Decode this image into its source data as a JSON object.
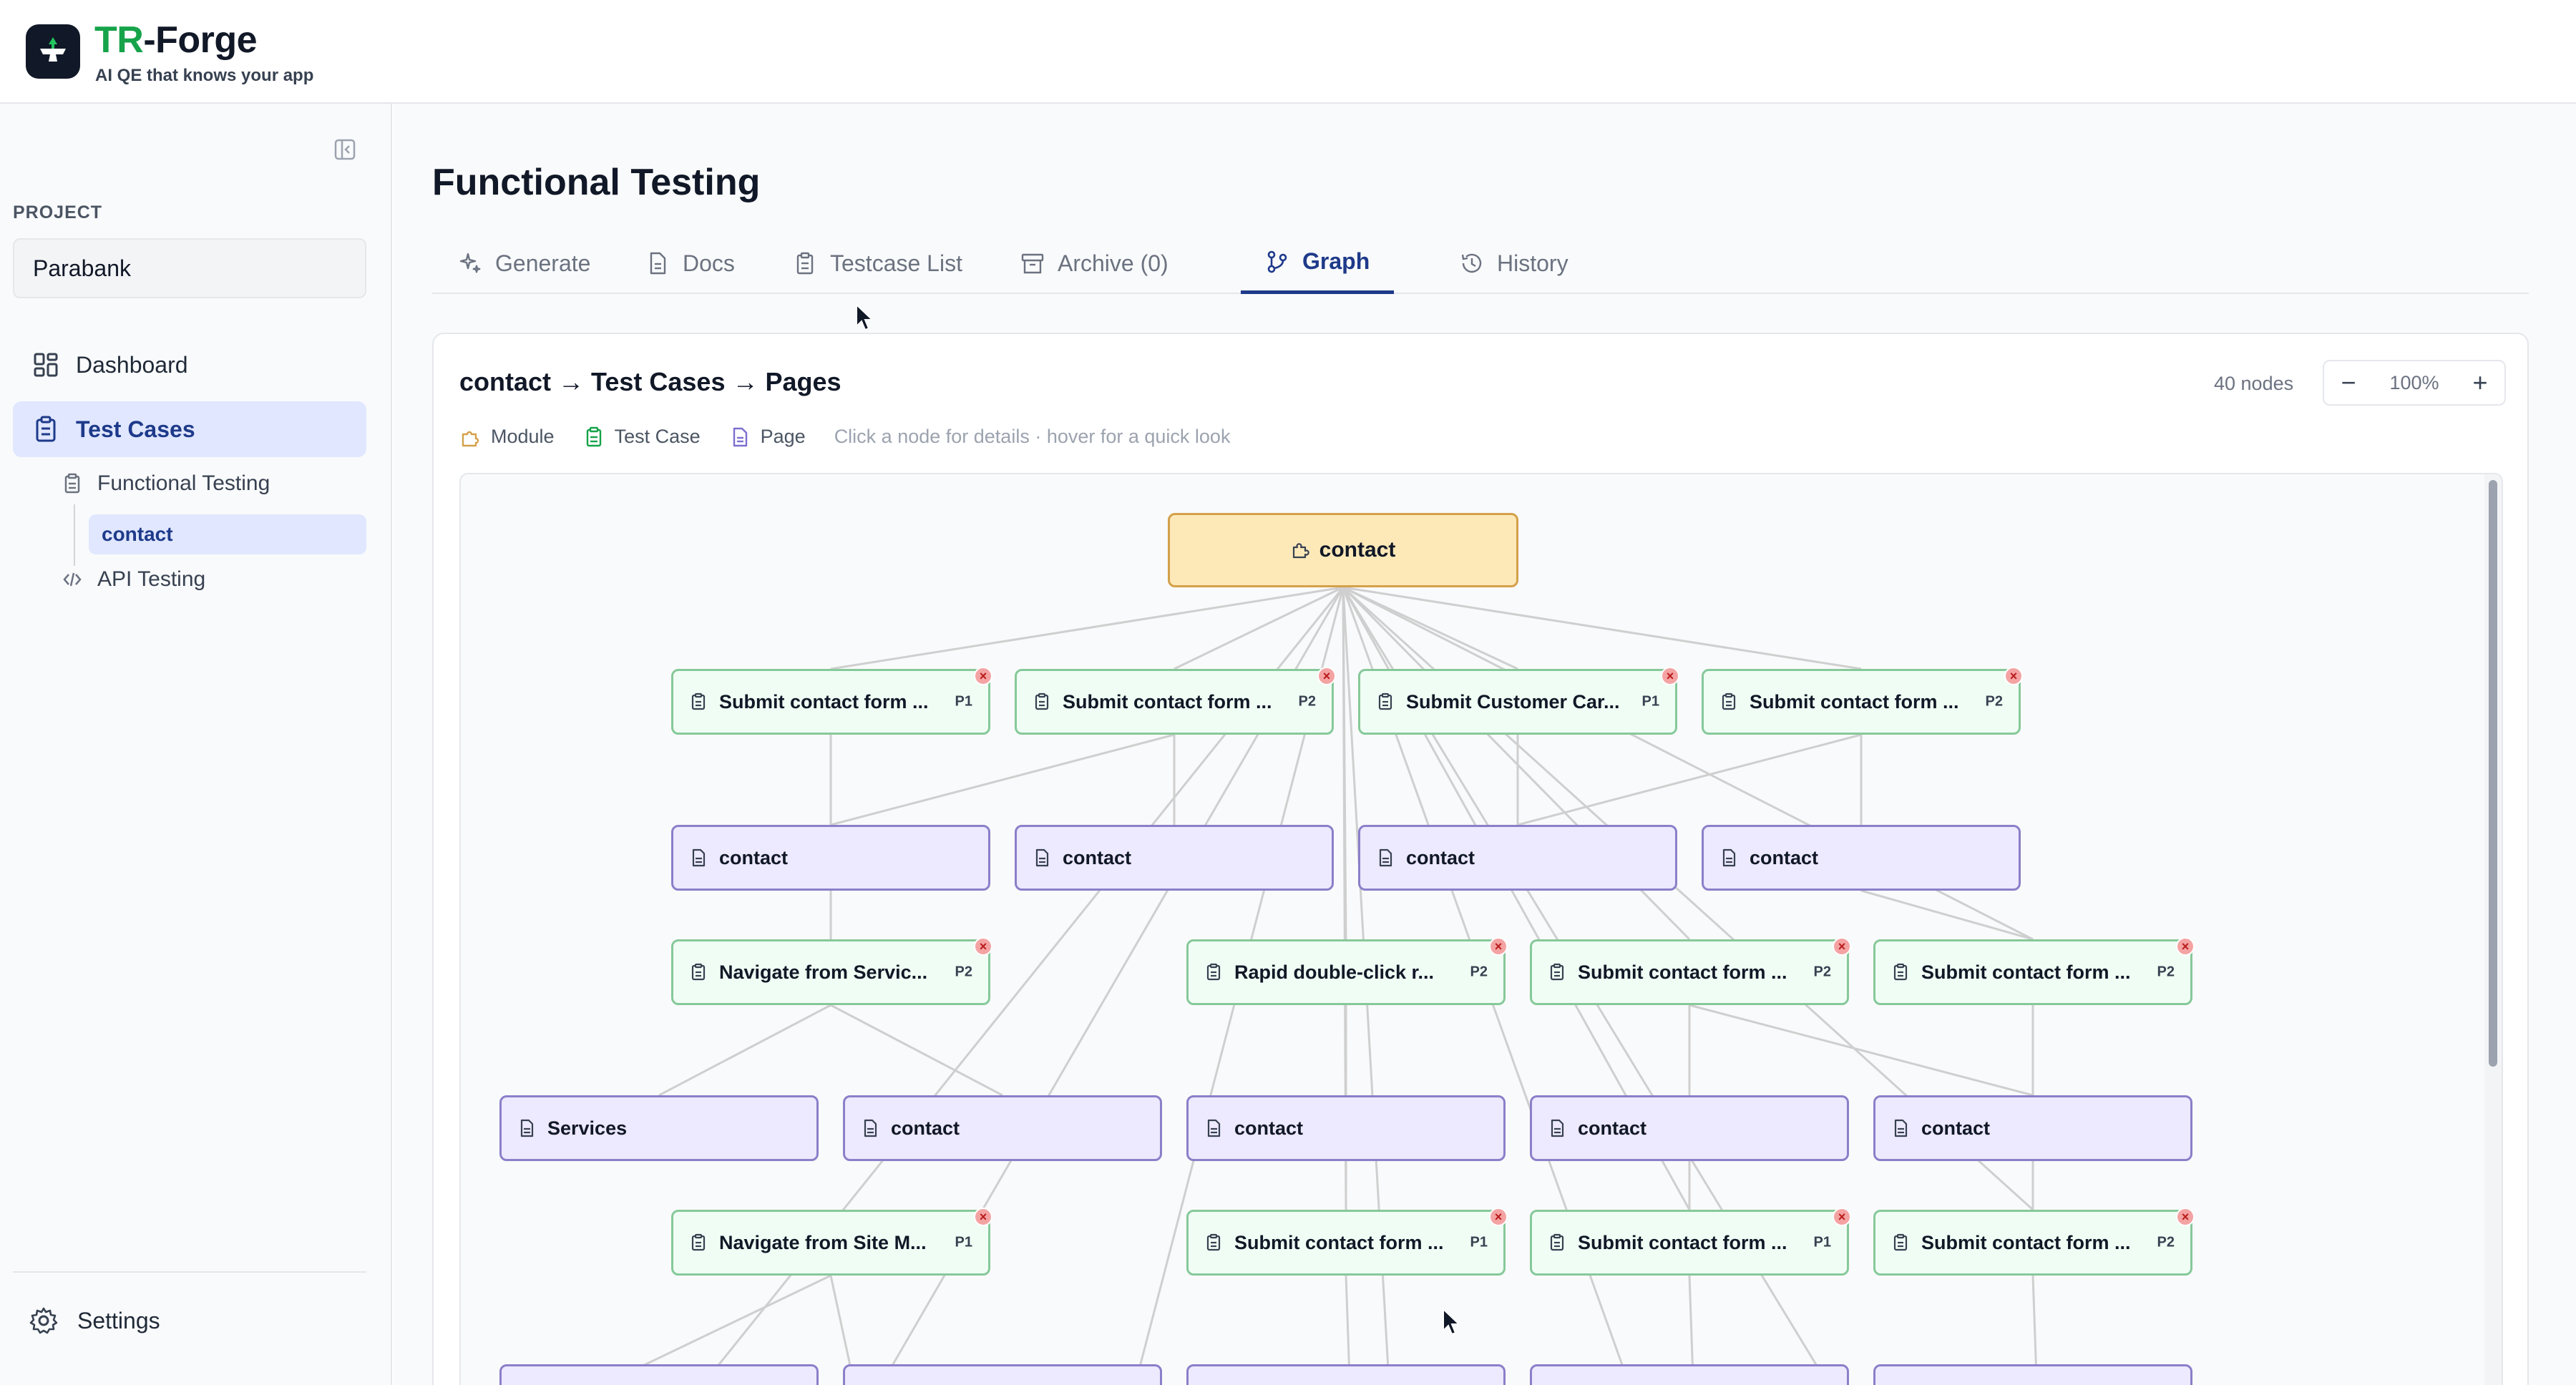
{
  "app": {
    "brand_prefix": "TR",
    "brand_suffix": "-Forge",
    "tagline": "AI QE that knows your app"
  },
  "sidebar": {
    "project_label": "PROJECT",
    "project_value": "Parabank",
    "items": [
      {
        "label": "Dashboard",
        "icon": "dashboard-icon"
      },
      {
        "label": "Test Cases",
        "icon": "clipboard-icon"
      }
    ],
    "sub_items": [
      {
        "label": "Functional Testing",
        "icon": "clipboard-icon"
      },
      {
        "label": "contact"
      },
      {
        "label": "API Testing",
        "icon": "code-icon"
      }
    ],
    "settings_label": "Settings"
  },
  "main": {
    "title": "Functional Testing",
    "tabs": [
      {
        "label": "Generate",
        "icon": "sparkles-icon"
      },
      {
        "label": "Docs",
        "icon": "document-icon"
      },
      {
        "label": "Testcase List",
        "icon": "clipboard-icon"
      },
      {
        "label": "Archive (0)",
        "icon": "archive-icon"
      },
      {
        "label": "Graph",
        "icon": "graph-icon",
        "active": true
      },
      {
        "label": "History",
        "icon": "history-icon"
      }
    ]
  },
  "graph": {
    "title": "contact → Test Cases → Pages",
    "node_count": "40 nodes",
    "zoom_minus": "−",
    "zoom_level": "100%",
    "zoom_plus": "+",
    "legend": {
      "module": "Module",
      "test_case": "Test Case",
      "page": "Page",
      "hint": "Click a node for details · hover for a quick look"
    },
    "colors": {
      "module_fill": "#fde9b8",
      "test_case_fill": "#f0fdf4",
      "page_fill": "#ede9fe",
      "accent": "#1e3a8a"
    },
    "module_node": {
      "label": "contact"
    },
    "nodes": [
      {
        "id": "tc1",
        "type": "test_case",
        "label": "Submit contact form ...",
        "priority": "P1"
      },
      {
        "id": "tc2",
        "type": "test_case",
        "label": "Submit contact form ...",
        "priority": "P2"
      },
      {
        "id": "tc3",
        "type": "test_case",
        "label": "Submit Customer Car...",
        "priority": "P1"
      },
      {
        "id": "tc4",
        "type": "test_case",
        "label": "Submit contact form ...",
        "priority": "P2"
      },
      {
        "id": "pg1",
        "type": "page",
        "label": "contact"
      },
      {
        "id": "pg2",
        "type": "page",
        "label": "contact"
      },
      {
        "id": "pg3",
        "type": "page",
        "label": "contact"
      },
      {
        "id": "pg4",
        "type": "page",
        "label": "contact"
      },
      {
        "id": "tc5",
        "type": "test_case",
        "label": "Navigate from Servic...",
        "priority": "P2"
      },
      {
        "id": "tc6",
        "type": "test_case",
        "label": "Rapid double-click r...",
        "priority": "P2"
      },
      {
        "id": "tc7",
        "type": "test_case",
        "label": "Submit contact form ...",
        "priority": "P2"
      },
      {
        "id": "tc8",
        "type": "test_case",
        "label": "Submit contact form ...",
        "priority": "P2"
      },
      {
        "id": "pg5",
        "type": "page",
        "label": "Services"
      },
      {
        "id": "pg6",
        "type": "page",
        "label": "contact"
      },
      {
        "id": "pg7",
        "type": "page",
        "label": "contact"
      },
      {
        "id": "pg8",
        "type": "page",
        "label": "contact"
      },
      {
        "id": "pg9",
        "type": "page",
        "label": "contact"
      },
      {
        "id": "tc9",
        "type": "test_case",
        "label": "Navigate from Site M...",
        "priority": "P1"
      },
      {
        "id": "tc10",
        "type": "test_case",
        "label": "Submit contact form ...",
        "priority": "P1"
      },
      {
        "id": "tc11",
        "type": "test_case",
        "label": "Submit contact form ...",
        "priority": "P1"
      },
      {
        "id": "tc12",
        "type": "test_case",
        "label": "Submit contact form ...",
        "priority": "P2"
      }
    ]
  }
}
